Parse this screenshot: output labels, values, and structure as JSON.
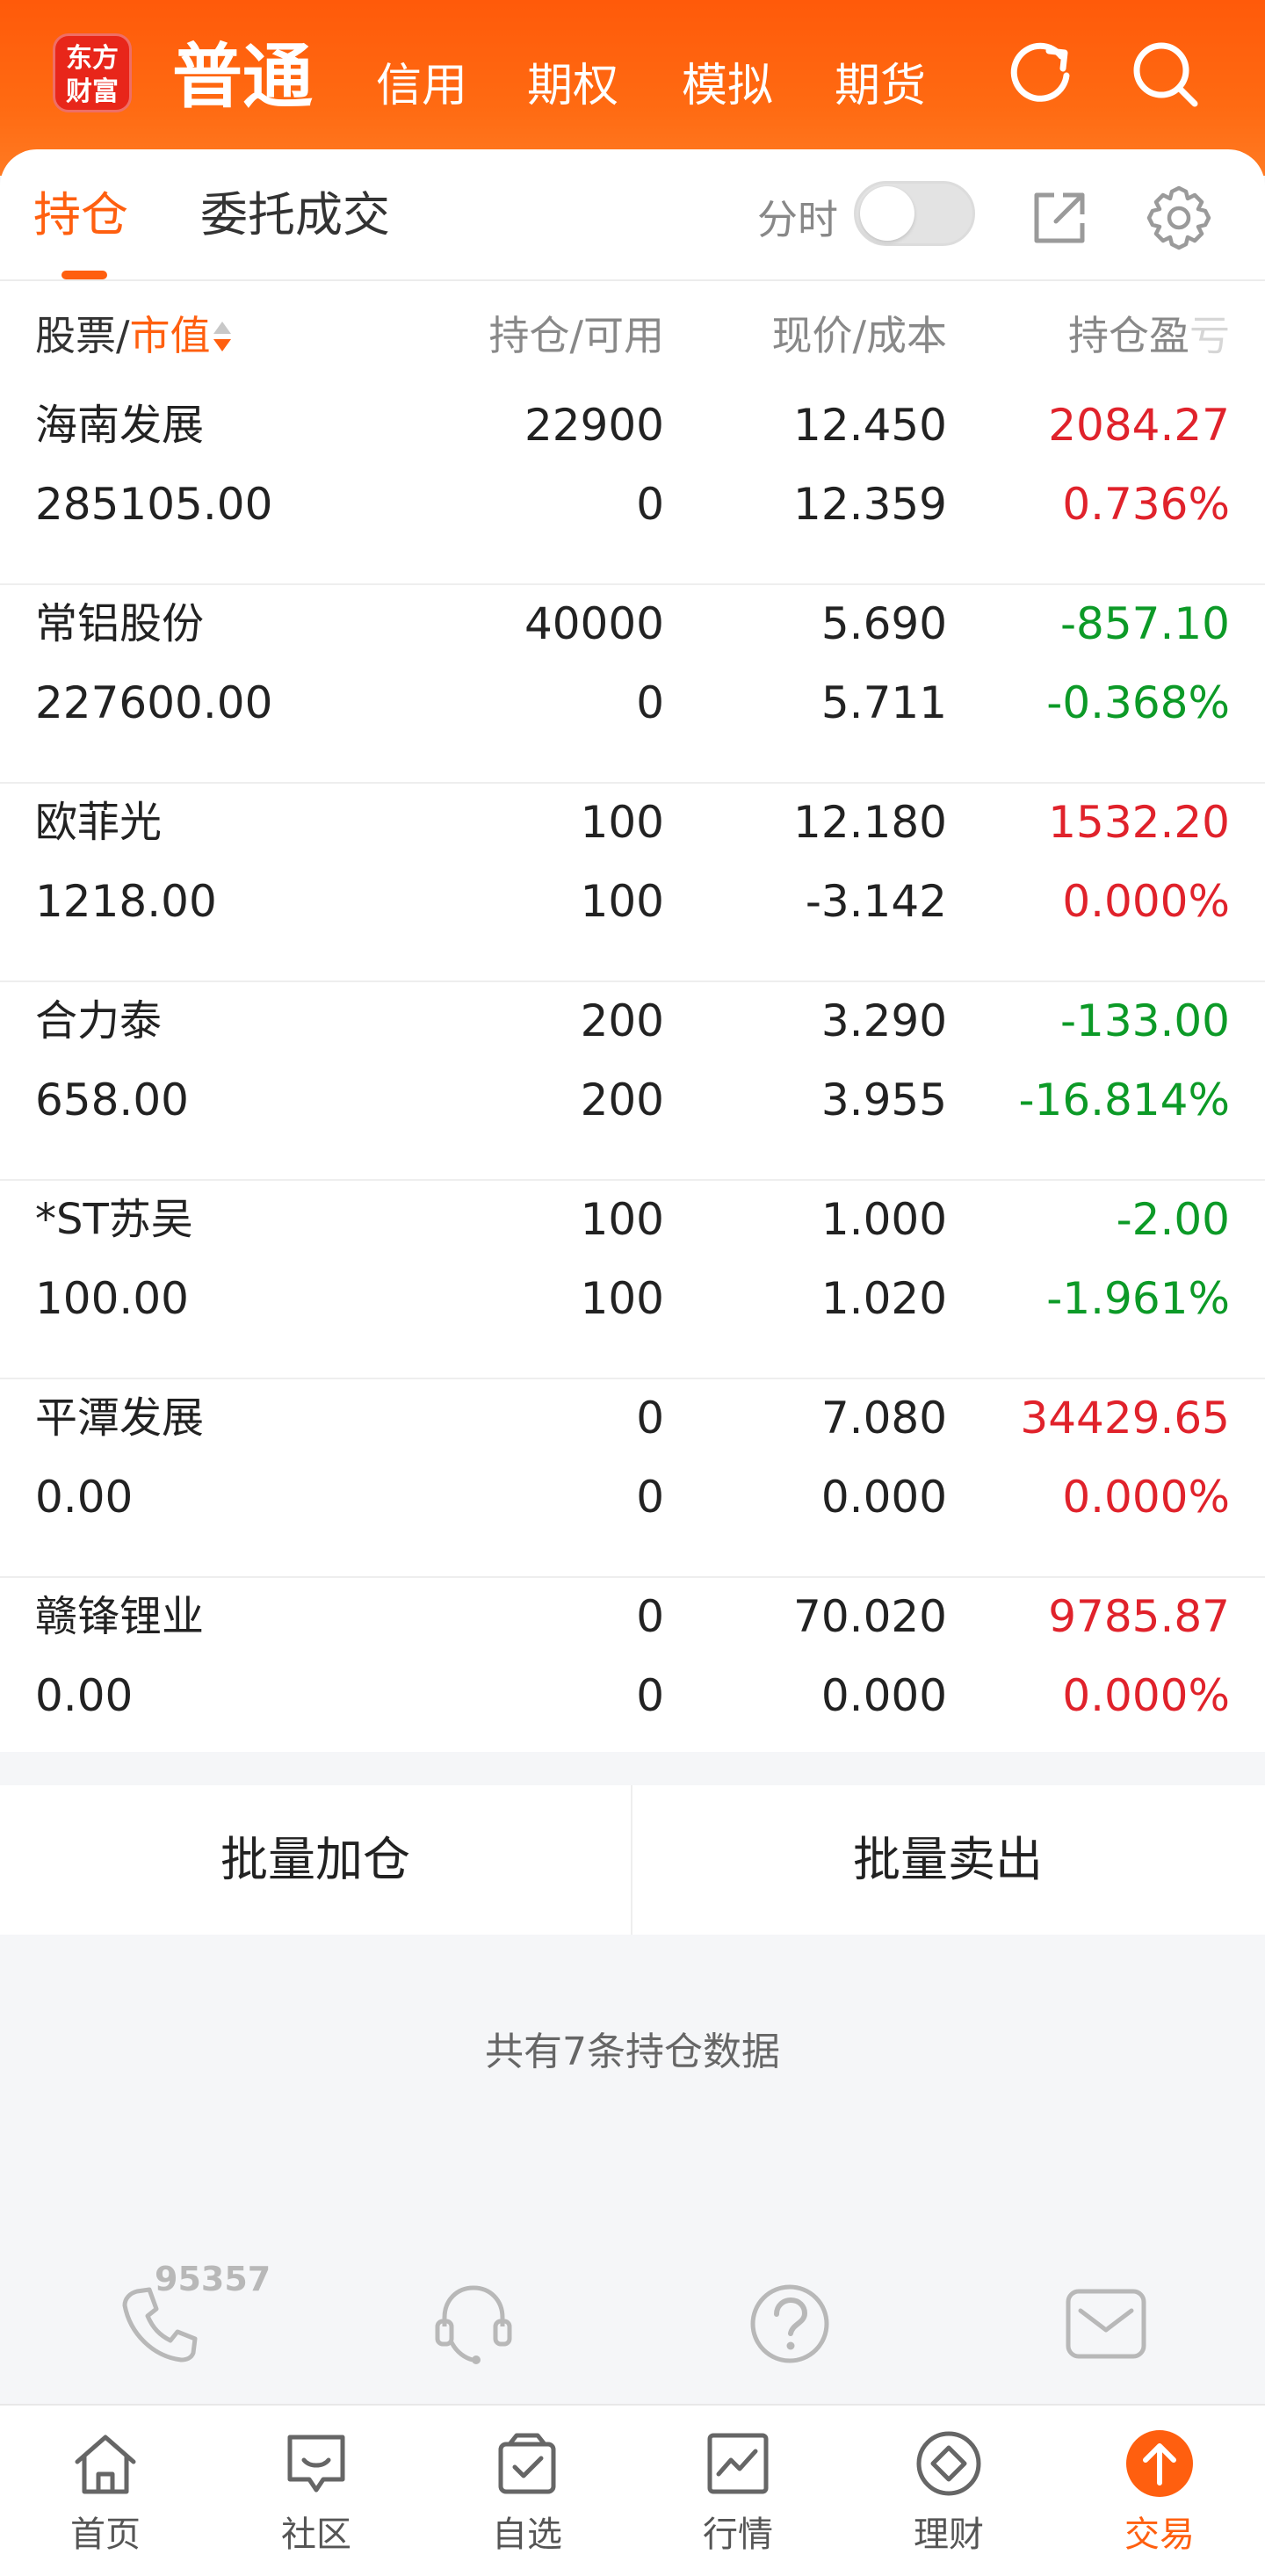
{
  "header": {
    "logo_line1": "东方",
    "logo_line2": "财富",
    "tabs": [
      "普通",
      "信用",
      "期权",
      "模拟",
      "期货"
    ],
    "active_tab": "普通"
  },
  "subtabs": {
    "position": "持仓",
    "orders": "委托成交",
    "fenshi_label": "分时",
    "fenshi_on": false
  },
  "table": {
    "headers": {
      "name_a": "股票",
      "name_sep": "/",
      "name_b": "市值",
      "position": "持仓/可用",
      "price": "现价/成本",
      "pl_a": "持仓盈",
      "pl_b": "亏"
    },
    "rows": [
      {
        "name": "海南发展",
        "market_value": "285105.00",
        "holding": "22900",
        "available": "0",
        "price": "12.450",
        "cost": "12.359",
        "pl": "2084.27",
        "pl_pct": "0.736%",
        "pl_color": "red",
        "pct_color": "red"
      },
      {
        "name": "常铝股份",
        "market_value": "227600.00",
        "holding": "40000",
        "available": "0",
        "price": "5.690",
        "cost": "5.711",
        "pl": "-857.10",
        "pl_pct": "-0.368%",
        "pl_color": "green",
        "pct_color": "green"
      },
      {
        "name": "欧菲光",
        "market_value": "1218.00",
        "holding": "100",
        "available": "100",
        "price": "12.180",
        "cost": "-3.142",
        "pl": "1532.20",
        "pl_pct": "0.000%",
        "pl_color": "red",
        "pct_color": "red"
      },
      {
        "name": "合力泰",
        "market_value": "658.00",
        "holding": "200",
        "available": "200",
        "price": "3.290",
        "cost": "3.955",
        "pl": "-133.00",
        "pl_pct": "-16.814%",
        "pl_color": "green",
        "pct_color": "green"
      },
      {
        "name": "*ST苏吴",
        "market_value": "100.00",
        "holding": "100",
        "available": "100",
        "price": "1.000",
        "cost": "1.020",
        "pl": "-2.00",
        "pl_pct": "-1.961%",
        "pl_color": "green",
        "pct_color": "green"
      },
      {
        "name": "平潭发展",
        "market_value": "0.00",
        "holding": "0",
        "available": "0",
        "price": "7.080",
        "cost": "0.000",
        "pl": "34429.65",
        "pl_pct": "0.000%",
        "pl_color": "red",
        "pct_color": "red"
      },
      {
        "name": "赣锋锂业",
        "market_value": "0.00",
        "holding": "0",
        "available": "0",
        "price": "70.020",
        "cost": "0.000",
        "pl": "9785.87",
        "pl_pct": "0.000%",
        "pl_color": "red",
        "pct_color": "red"
      }
    ]
  },
  "batch": {
    "add": "批量加仓",
    "sell": "批量卖出"
  },
  "count_text": "共有7条持仓数据",
  "service": {
    "hotline": "95357",
    "icons": [
      "phone-icon",
      "headset-icon",
      "help-icon",
      "mail-icon"
    ]
  },
  "nav": [
    {
      "label": "首页",
      "icon": "home-icon"
    },
    {
      "label": "社区",
      "icon": "community-icon"
    },
    {
      "label": "自选",
      "icon": "watchlist-icon"
    },
    {
      "label": "行情",
      "icon": "market-icon"
    },
    {
      "label": "理财",
      "icon": "wealth-icon"
    },
    {
      "label": "交易",
      "icon": "trade-icon",
      "active": true
    }
  ],
  "colors": {
    "accent": "#ff5f0f",
    "up": "#e0222b",
    "down": "#0c9a27"
  }
}
